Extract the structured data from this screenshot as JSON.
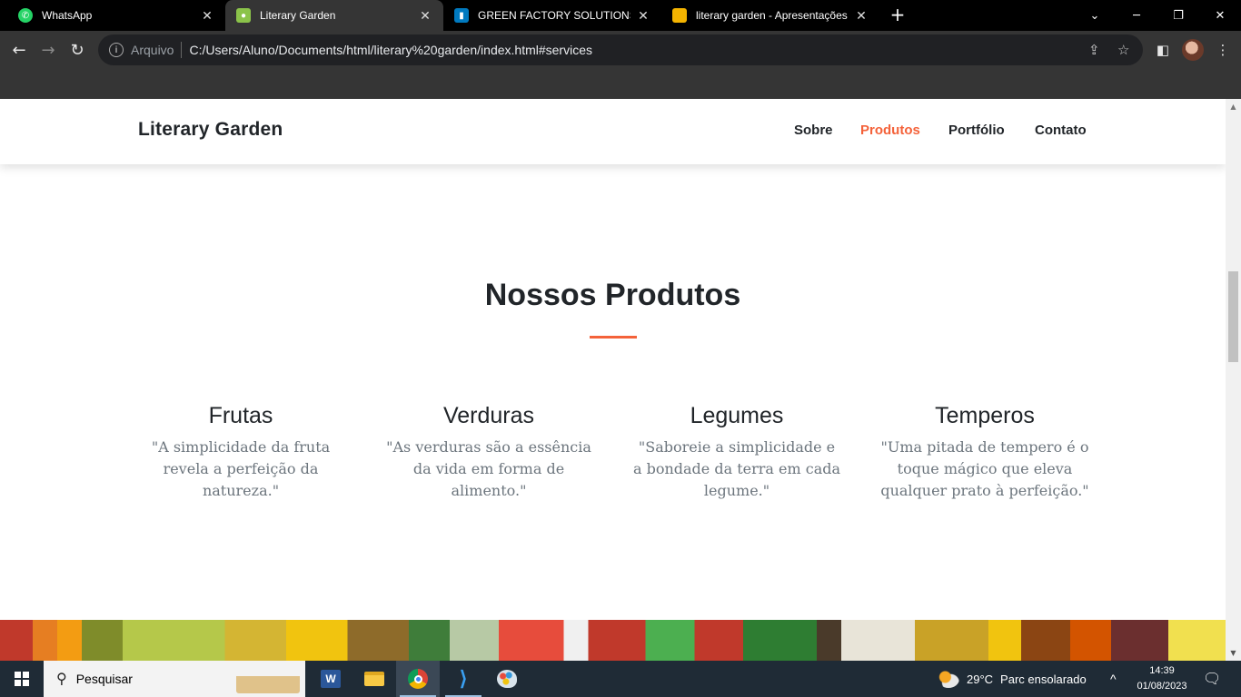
{
  "browser": {
    "tabs": [
      {
        "title": "WhatsApp",
        "favicon": "whatsapp-icon",
        "active": false
      },
      {
        "title": "Literary Garden",
        "favicon": "page-icon",
        "active": true
      },
      {
        "title": "GREEN FACTORY SOLUTIONS | Tr",
        "favicon": "trello-icon",
        "active": false
      },
      {
        "title": "literary garden - Apresentações G",
        "favicon": "slides-icon",
        "active": false
      }
    ],
    "address": {
      "scheme_label": "Arquivo",
      "url": "C:/Users/Aluno/Documents/html/literary%20garden/index.html#services"
    }
  },
  "site": {
    "brand": "Literary Garden",
    "nav": [
      {
        "label": "Sobre",
        "active": false
      },
      {
        "label": "Produtos",
        "active": true
      },
      {
        "label": "Portfólio",
        "active": false
      },
      {
        "label": "Contato",
        "active": false
      }
    ],
    "accent_color": "#f4623a",
    "section_title": "Nossos Produtos",
    "products": [
      {
        "name": "Frutas",
        "description": "\"A simplicidade da fruta revela a perfeição da natureza.\""
      },
      {
        "name": "Verduras",
        "description": "\"As verduras são a essência da vida em forma de alimento.\""
      },
      {
        "name": "Legumes",
        "description": "\"Saboreie a simplicidade e a bondade da terra em cada legume.\""
      },
      {
        "name": "Temperos",
        "description": "\"Uma pitada de tempero é o toque mágico que eleva qualquer prato à perfeição.\""
      }
    ]
  },
  "taskbar": {
    "search_placeholder": "Pesquisar",
    "weather": {
      "temp": "29°C",
      "condition": "Parc ensolarado"
    },
    "time": "14:39",
    "date": "01/08/2023"
  }
}
